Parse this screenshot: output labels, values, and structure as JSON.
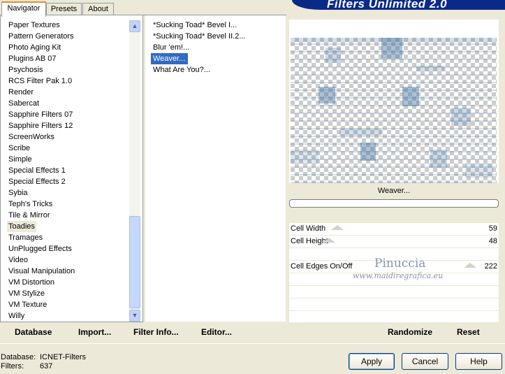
{
  "app_title": "Filters Unlimited 2.0",
  "tabs": [
    {
      "label": "Navigator",
      "active": true
    },
    {
      "label": "Presets",
      "active": false
    },
    {
      "label": "About",
      "active": false
    }
  ],
  "categories": {
    "items": [
      "Paper Textures",
      "Pattern Generators",
      "Photo Aging Kit",
      "Plugins AB 07",
      "Psychosis",
      "RCS Filter Pak 1.0",
      "Render",
      "Sabercat",
      "Sapphire Filters 07",
      "Sapphire Filters 12",
      "ScreenWorks",
      "Scribe",
      "Simple",
      "Special Effects 1",
      "Special Effects 2",
      "Sybia",
      "Teph's Tricks",
      "Tile & Mirror",
      "Toadies",
      "Tramages",
      "UnPlugged Effects",
      "Video",
      "Visual Manipulation",
      "VM Distortion",
      "VM Stylize",
      "VM Texture",
      "Willy"
    ],
    "selected": "Toadies"
  },
  "filters": {
    "items": [
      "*Sucking Toad*  Bevel I...",
      "*Sucking Toad*  Bevel II.2...",
      "Blur 'em!...",
      "Weaver...",
      "What Are You?..."
    ],
    "selected": "Weaver..."
  },
  "preview": {
    "filter_name": "Weaver...",
    "progress": 0
  },
  "params": [
    {
      "label": "Cell Width",
      "value": "59"
    },
    {
      "label": "Cell Height",
      "value": "48"
    },
    {
      "label": "",
      "value": ""
    },
    {
      "label": "Cell Edges On/Off",
      "value": "222"
    }
  ],
  "watermark": {
    "name": "Pinuccia",
    "url": "www.maidiregrafica.eu"
  },
  "toolbar": {
    "database": "Database",
    "import": "Import...",
    "filter_info": "Filter Info...",
    "editor": "Editor...",
    "randomize": "Randomize",
    "reset": "Reset"
  },
  "status": {
    "database_label": "Database:",
    "database_value": "ICNET-Filters",
    "filters_label": "Filters:",
    "filters_value": "637"
  },
  "buttons": {
    "apply": "Apply",
    "cancel": "Cancel",
    "help": "Help"
  },
  "colors": {
    "selection": "#316ac5",
    "banner": "#0a2a8a",
    "face": "#ece9d8"
  },
  "icons": {
    "scroll_up": "chevron-up-icon",
    "scroll_down": "chevron-down-icon"
  }
}
